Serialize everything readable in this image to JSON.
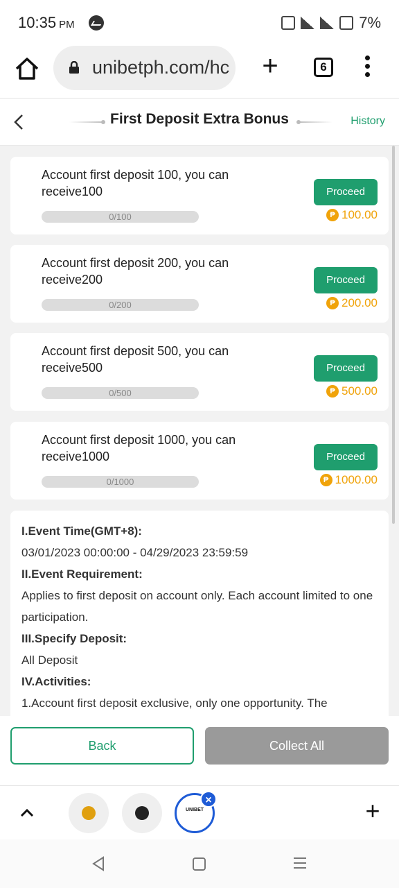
{
  "status_bar": {
    "time": "10:35",
    "ampm": "PM",
    "battery": "7%"
  },
  "browser": {
    "url": "unibetph.com/hc",
    "tab_count": "6"
  },
  "header": {
    "title": "First Deposit Extra Bonus",
    "history_label": "History"
  },
  "tasks": [
    {
      "text": "Account first deposit 100, you can receive100",
      "progress_label": "0/100",
      "progress": 0,
      "button_label": "Proceed",
      "reward": "100.00"
    },
    {
      "text": "Account first deposit 200, you can receive200",
      "progress_label": "0/200",
      "progress": 0,
      "button_label": "Proceed",
      "reward": "200.00"
    },
    {
      "text": "Account first deposit 500, you can receive500",
      "progress_label": "0/500",
      "progress": 0,
      "button_label": "Proceed",
      "reward": "500.00"
    },
    {
      "text": "Account first deposit 1000, you can receive1000",
      "progress_label": "0/1000",
      "progress": 0,
      "button_label": "Proceed",
      "reward": "1000.00"
    }
  ],
  "rules": {
    "event_time_heading": "I.Event Time(GMT+8):",
    "event_time_value": "03/01/2023 00:00:00 - 04/29/2023 23:59:59",
    "requirement_heading": "II.Event Requirement:",
    "requirement_value": "Applies to first deposit on account only. Each account limited to one participation.",
    "deposit_heading": "III.Specify Deposit:",
    "deposit_value": "All Deposit",
    "activities_heading": "IV.Activities:",
    "activities_value": "1.Account first deposit exclusive, only one opportunity. The"
  },
  "actions": {
    "back_label": "Back",
    "collect_label": "Collect All"
  },
  "tab_bar": {
    "active_tab_label": "UNIBET"
  },
  "colors": {
    "accent": "#1f9e6e",
    "coin": "#f0a30a",
    "disabled": "#9a9a9a",
    "tab_highlight": "#1e5bd6"
  }
}
